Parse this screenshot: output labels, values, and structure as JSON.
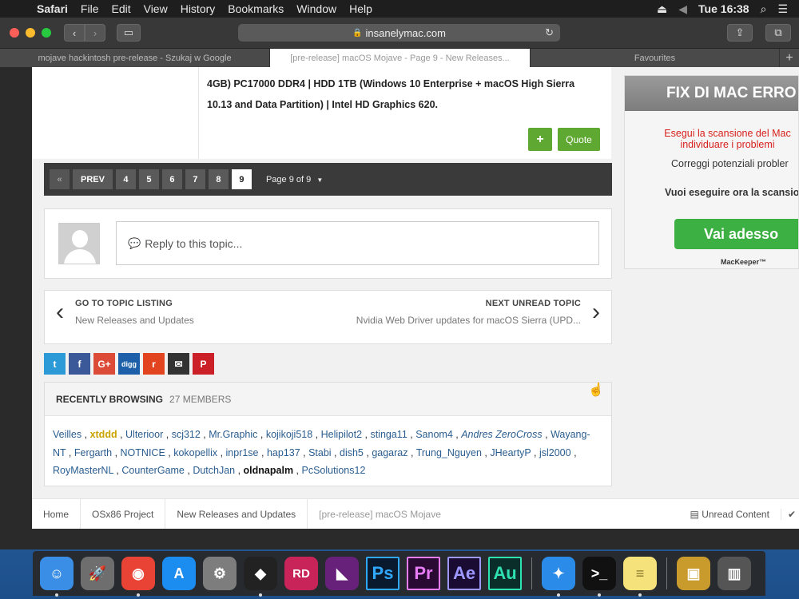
{
  "menubar": {
    "app": "Safari",
    "items": [
      "File",
      "Edit",
      "View",
      "History",
      "Bookmarks",
      "Window",
      "Help"
    ],
    "clock": "Tue 16:38"
  },
  "browser": {
    "url": "insanelymac.com",
    "tabs": [
      {
        "label": "mojave hackintosh pre-release - Szukaj w Google"
      },
      {
        "label": "[pre-release] macOS Mojave - Page 9 - New Releases..."
      },
      {
        "label": "Favourites"
      }
    ],
    "new_tab": "+"
  },
  "post": {
    "text": "4GB) PC17000 DDR4 | HDD 1TB (Windows 10 Enterprise + macOS High Sierra 10.13 and Data Partition) | Intel HD Graphics 620.",
    "plus_label": "+",
    "quote_label": "Quote"
  },
  "pagination": {
    "first": "«",
    "prev": "PREV",
    "pages": [
      "4",
      "5",
      "6",
      "7",
      "8",
      "9"
    ],
    "current": "9",
    "page_of": "Page 9 of 9"
  },
  "reply": {
    "placeholder": "Reply to this topic..."
  },
  "topic_nav": {
    "left_title": "GO TO TOPIC LISTING",
    "left_sub": "New Releases and Updates",
    "right_title": "NEXT UNREAD TOPIC",
    "right_sub": "Nvidia Web Driver updates for macOS Sierra (UPD..."
  },
  "share": [
    {
      "icon": "twitter-icon",
      "glyph": "t",
      "color": "#2d9ad8"
    },
    {
      "icon": "facebook-icon",
      "glyph": "f",
      "color": "#3b5998"
    },
    {
      "icon": "googleplus-icon",
      "glyph": "G+",
      "color": "#dc4a38"
    },
    {
      "icon": "digg-icon",
      "glyph": "digg",
      "color": "#1d5fa8"
    },
    {
      "icon": "reddit-icon",
      "glyph": "r",
      "color": "#e2441f"
    },
    {
      "icon": "email-icon",
      "glyph": "✉",
      "color": "#333333"
    },
    {
      "icon": "pinterest-icon",
      "glyph": "P",
      "color": "#cb2027"
    }
  ],
  "recent": {
    "title": "RECENTLY BROWSING",
    "count": "27 MEMBERS",
    "members": [
      {
        "name": "Veilles",
        "style": ""
      },
      {
        "name": "xtddd",
        "style": "gold"
      },
      {
        "name": "Ulterioor",
        "style": ""
      },
      {
        "name": "scj312",
        "style": ""
      },
      {
        "name": "Mr.Graphic",
        "style": ""
      },
      {
        "name": "kojikoji518",
        "style": ""
      },
      {
        "name": "Helipilot2",
        "style": ""
      },
      {
        "name": "stinga11",
        "style": ""
      },
      {
        "name": "Sanom4",
        "style": ""
      },
      {
        "name": "Andres ZeroCross",
        "style": "italic"
      },
      {
        "name": "Wayang-NT",
        "style": ""
      },
      {
        "name": "Fergarth",
        "style": ""
      },
      {
        "name": "NOTNICE",
        "style": ""
      },
      {
        "name": "kokopellix",
        "style": ""
      },
      {
        "name": "inpr1se",
        "style": ""
      },
      {
        "name": "hap137",
        "style": ""
      },
      {
        "name": "Stabi",
        "style": ""
      },
      {
        "name": "dish5",
        "style": ""
      },
      {
        "name": "gagaraz",
        "style": ""
      },
      {
        "name": "Trung_Nguyen",
        "style": ""
      },
      {
        "name": "JHeartyP",
        "style": ""
      },
      {
        "name": "jsl2000",
        "style": ""
      },
      {
        "name": "RoyMasterNL",
        "style": ""
      },
      {
        "name": "CounterGame",
        "style": ""
      },
      {
        "name": "DutchJan",
        "style": ""
      },
      {
        "name": "oldnapalm",
        "style": "black"
      },
      {
        "name": "PcSolutions12",
        "style": ""
      }
    ]
  },
  "breadcrumb": {
    "items": [
      "Home",
      "OSx86 Project",
      "New Releases and Updates",
      "[pre-release] macOS Mojave"
    ],
    "unread": "Unread Content"
  },
  "ad": {
    "title": "FIX DI MAC ERRO",
    "red_line1": "Esegui la scansione del Mac",
    "red_line2": "individuare i problemi",
    "line1": "Correggi potenziali probler",
    "line2": "Vuoi eseguire ora la scansio",
    "button": "Vai adesso",
    "brand": "MacKeeper™"
  },
  "dock": [
    {
      "name": "finder-icon",
      "glyph": "☺",
      "color": "#3a8ee6"
    },
    {
      "name": "launchpad-icon",
      "glyph": "🚀",
      "color": "#6e6e6e"
    },
    {
      "name": "chrome-icon",
      "glyph": "◉",
      "color": "#e94335"
    },
    {
      "name": "appstore-icon",
      "glyph": "A",
      "color": "#1b8cf0"
    },
    {
      "name": "system-preferences-icon",
      "glyph": "⚙",
      "color": "#7d7d7d"
    },
    {
      "name": "unity-icon",
      "glyph": "◆",
      "color": "#222222"
    },
    {
      "name": "rider-icon",
      "glyph": "RD",
      "color": "#c9245a"
    },
    {
      "name": "visual-studio-icon",
      "glyph": "◣",
      "color": "#68217a"
    },
    {
      "name": "photoshop-icon",
      "glyph": "Ps",
      "color": "#0a1a2e"
    },
    {
      "name": "premiere-icon",
      "glyph": "Pr",
      "color": "#2a0a33"
    },
    {
      "name": "after-effects-icon",
      "glyph": "Ae",
      "color": "#1a0b33"
    },
    {
      "name": "audition-icon",
      "glyph": "Au",
      "color": "#0a2e2a"
    },
    {
      "name": "safari-icon",
      "glyph": "✦",
      "color": "#2b8be8"
    },
    {
      "name": "terminal-icon",
      "glyph": ">_",
      "color": "#111111"
    },
    {
      "name": "notes-icon",
      "glyph": "≡",
      "color": "#f5e27a"
    },
    {
      "name": "archive-icon",
      "glyph": "▣",
      "color": "#c99b2c"
    },
    {
      "name": "trash-icon",
      "glyph": "▥",
      "color": "#555555"
    }
  ]
}
